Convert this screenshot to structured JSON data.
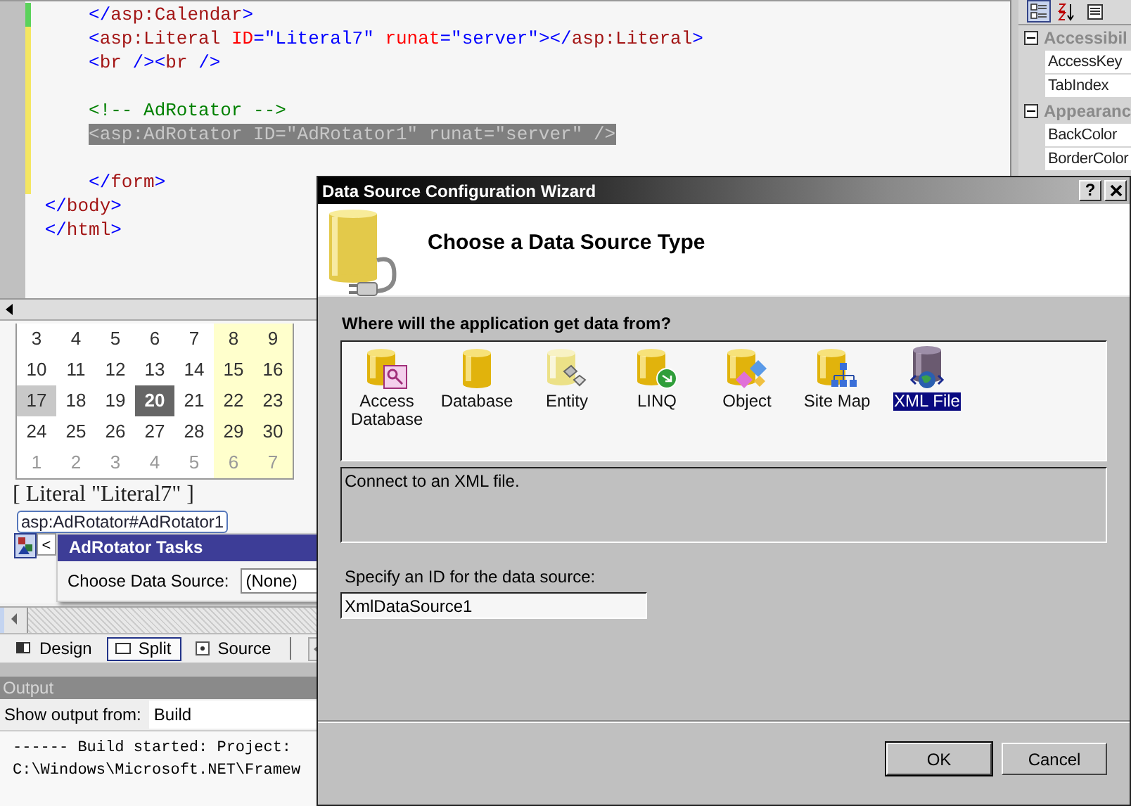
{
  "editor": {
    "lines": [
      {
        "color": "#5bd25b",
        "selected": false,
        "tokens": [
          {
            "kind": "delim",
            "text": "     </"
          },
          {
            "kind": "tag",
            "text": "asp:Calendar"
          },
          {
            "kind": "delim",
            "text": ">"
          }
        ]
      },
      {
        "color": "#f4e661",
        "selected": false,
        "tokens": [
          {
            "kind": "delim",
            "text": "     <"
          },
          {
            "kind": "tag",
            "text": "asp:Literal"
          },
          {
            "kind": "attr",
            "text": " ID"
          },
          {
            "kind": "delim",
            "text": "="
          },
          {
            "kind": "value",
            "text": "\"Literal7\""
          },
          {
            "kind": "attr",
            "text": " runat"
          },
          {
            "kind": "delim",
            "text": "="
          },
          {
            "kind": "value",
            "text": "\"server\""
          },
          {
            "kind": "delim",
            "text": "></"
          },
          {
            "kind": "tag",
            "text": "asp:Literal"
          },
          {
            "kind": "delim",
            "text": ">"
          }
        ]
      },
      {
        "color": "#f4e661",
        "selected": false,
        "tokens": [
          {
            "kind": "delim",
            "text": "     <"
          },
          {
            "kind": "tag",
            "text": "br"
          },
          {
            "kind": "delim",
            "text": " /><"
          },
          {
            "kind": "tag",
            "text": "br"
          },
          {
            "kind": "delim",
            "text": " />"
          }
        ]
      },
      {
        "color": "#f4e661",
        "selected": false
      },
      {
        "color": "#f4e661",
        "selected": false,
        "tokens": [
          {
            "kind": "comment",
            "text": "     <!-- AdRotator -->"
          }
        ]
      },
      {
        "color": "#f4e661",
        "selected": true,
        "tokens": [
          {
            "kind": "delim",
            "text": "     <"
          },
          {
            "kind": "tag",
            "text": "asp:AdRotator"
          },
          {
            "kind": "attr",
            "text": " ID"
          },
          {
            "kind": "delim",
            "text": "="
          },
          {
            "kind": "value",
            "text": "\"AdRotator1\""
          },
          {
            "kind": "attr",
            "text": " runat"
          },
          {
            "kind": "delim",
            "text": "="
          },
          {
            "kind": "value",
            "text": "\"server\""
          },
          {
            "kind": "delim",
            "text": " />"
          }
        ]
      },
      {
        "color": "#f4e661",
        "selected": false
      },
      {
        "color": "#f4e661",
        "selected": false,
        "tokens": [
          {
            "kind": "delim",
            "text": "     </"
          },
          {
            "kind": "tag",
            "text": "form"
          },
          {
            "kind": "delim",
            "text": ">"
          }
        ]
      },
      {
        "selected": false,
        "tokens": [
          {
            "kind": "delim",
            "text": " </"
          },
          {
            "kind": "tag",
            "text": "body"
          },
          {
            "kind": "delim",
            "text": ">"
          }
        ]
      },
      {
        "selected": false,
        "tokens": [
          {
            "kind": "delim",
            "text": " </"
          },
          {
            "kind": "tag",
            "text": "html"
          },
          {
            "kind": "delim",
            "text": ">"
          }
        ]
      }
    ]
  },
  "design": {
    "calendar": {
      "weeks": [
        {
          "days": [
            {
              "text": "3",
              "weekend": false,
              "other_month": false,
              "today": false,
              "selected": false
            },
            {
              "text": "4",
              "weekend": false,
              "other_month": false,
              "today": false,
              "selected": false
            },
            {
              "text": "5",
              "weekend": false,
              "other_month": false,
              "today": false,
              "selected": false
            },
            {
              "text": "6",
              "weekend": false,
              "other_month": false,
              "today": false,
              "selected": false
            },
            {
              "text": "7",
              "weekend": false,
              "other_month": false,
              "today": false,
              "selected": false
            },
            {
              "text": "8",
              "weekend": true,
              "other_month": false,
              "today": false,
              "selected": false
            },
            {
              "text": "9",
              "weekend": true,
              "other_month": false,
              "today": false,
              "selected": false
            }
          ]
        },
        {
          "days": [
            {
              "text": "10",
              "weekend": false,
              "other_month": false,
              "today": false,
              "selected": false
            },
            {
              "text": "11",
              "weekend": false,
              "other_month": false,
              "today": false,
              "selected": false
            },
            {
              "text": "12",
              "weekend": false,
              "other_month": false,
              "today": false,
              "selected": false
            },
            {
              "text": "13",
              "weekend": false,
              "other_month": false,
              "today": false,
              "selected": false
            },
            {
              "text": "14",
              "weekend": false,
              "other_month": false,
              "today": false,
              "selected": false
            },
            {
              "text": "15",
              "weekend": true,
              "other_month": false,
              "today": false,
              "selected": false
            },
            {
              "text": "16",
              "weekend": true,
              "other_month": false,
              "today": false,
              "selected": false
            }
          ]
        },
        {
          "days": [
            {
              "text": "17",
              "weekend": false,
              "other_month": false,
              "today": true,
              "selected": false
            },
            {
              "text": "18",
              "weekend": false,
              "other_month": false,
              "today": false,
              "selected": false
            },
            {
              "text": "19",
              "weekend": false,
              "other_month": false,
              "today": false,
              "selected": false
            },
            {
              "text": "20",
              "weekend": false,
              "other_month": false,
              "today": false,
              "selected": true
            },
            {
              "text": "21",
              "weekend": false,
              "other_month": false,
              "today": false,
              "selected": false
            },
            {
              "text": "22",
              "weekend": true,
              "other_month": false,
              "today": false,
              "selected": false
            },
            {
              "text": "23",
              "weekend": true,
              "other_month": false,
              "today": false,
              "selected": false
            }
          ]
        },
        {
          "days": [
            {
              "text": "24",
              "weekend": false,
              "other_month": false,
              "today": false,
              "selected": false
            },
            {
              "text": "25",
              "weekend": false,
              "other_month": false,
              "today": false,
              "selected": false
            },
            {
              "text": "26",
              "weekend": false,
              "other_month": false,
              "today": false,
              "selected": false
            },
            {
              "text": "27",
              "weekend": false,
              "other_month": false,
              "today": false,
              "selected": false
            },
            {
              "text": "28",
              "weekend": false,
              "other_month": false,
              "today": false,
              "selected": false
            },
            {
              "text": "29",
              "weekend": true,
              "other_month": false,
              "today": false,
              "selected": false
            },
            {
              "text": "30",
              "weekend": true,
              "other_month": false,
              "today": false,
              "selected": false
            }
          ]
        },
        {
          "days": [
            {
              "text": "1",
              "weekend": false,
              "other_month": true,
              "today": false,
              "selected": false
            },
            {
              "text": "2",
              "weekend": false,
              "other_month": true,
              "today": false,
              "selected": false
            },
            {
              "text": "3",
              "weekend": false,
              "other_month": true,
              "today": false,
              "selected": false
            },
            {
              "text": "4",
              "weekend": false,
              "other_month": true,
              "today": false,
              "selected": false
            },
            {
              "text": "5",
              "weekend": false,
              "other_month": true,
              "today": false,
              "selected": false
            },
            {
              "text": "6",
              "weekend": true,
              "other_month": true,
              "today": false,
              "selected": false
            },
            {
              "text": "7",
              "weekend": true,
              "other_month": true,
              "today": false,
              "selected": false
            }
          ]
        }
      ]
    },
    "literal": "[ Literal \"Literal7\" ]",
    "control_tag": "asp:AdRotator#AdRotator1",
    "smart_tag": "<",
    "tasks": {
      "title": "AdRotator Tasks",
      "field_label": "Choose Data Source:",
      "field_value": "(None)"
    },
    "views": [
      {
        "label": "Design",
        "selected": false
      },
      {
        "label": "Split",
        "selected": true
      },
      {
        "label": "Source",
        "selected": false
      }
    ]
  },
  "output": {
    "title": "Output",
    "source_label": "Show output from:",
    "source_value": "Build",
    "lines": [
      "------ Build started: Project:",
      "C:\\Windows\\Microsoft.NET\\Framew"
    ]
  },
  "properties": {
    "toolbar": [
      {
        "selected": true
      },
      {
        "selected": false
      },
      {
        "selected": false
      }
    ],
    "categories": [
      {
        "name": "Accessibil",
        "expanded": true,
        "properties": [
          "AccessKey",
          "TabIndex"
        ]
      },
      {
        "name": "Appearanc",
        "expanded": true,
        "properties": [
          "BackColor",
          "BorderColor"
        ]
      }
    ]
  },
  "dialog": {
    "title": "Data Source Configuration Wizard",
    "help": "?",
    "heading": "Choose a Data Source Type",
    "question": "Where will the application get data from?",
    "types": [
      {
        "label": "Access Database",
        "selected": false
      },
      {
        "label": "Database",
        "selected": false
      },
      {
        "label": "Entity",
        "selected": false
      },
      {
        "label": "LINQ",
        "selected": false
      },
      {
        "label": "Object",
        "selected": false
      },
      {
        "label": "Site Map",
        "selected": false
      },
      {
        "label": "XML File",
        "selected": true
      }
    ],
    "description": "Connect to an XML file.",
    "id_label": "Specify an ID for the data source:",
    "id_value": "XmlDataSource1",
    "buttons": [
      {
        "label": "OK",
        "default": true
      },
      {
        "label": "Cancel",
        "default": false
      }
    ]
  }
}
